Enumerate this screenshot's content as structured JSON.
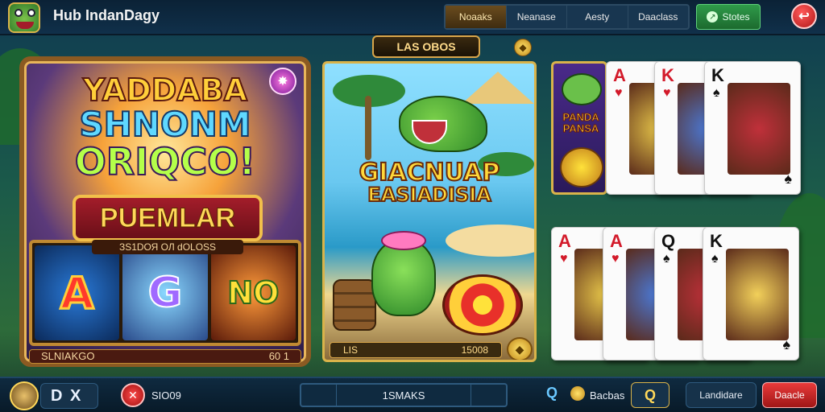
{
  "header": {
    "app_title": "Hub IndanDagy",
    "tabs": [
      "Noaaks",
      "Neanase",
      "Aesty",
      "Daaclass"
    ],
    "active_tab": 0,
    "stats_label": "Stotes",
    "stats_icon": "chart-icon",
    "close_icon": "close-icon"
  },
  "slot": {
    "headline_1": "YADDABA",
    "headline_2": "SHNONM",
    "headline_3": "ORIQCO!",
    "banner": "PUEMLAR",
    "banner_sub": "ЗS1DОЯ ОЛ dOLOSS",
    "reels": [
      "A",
      "G",
      "NO"
    ],
    "footer_left": "SLNIAKGO",
    "footer_right": "60 1",
    "gem_icon": "gem-icon"
  },
  "scene": {
    "top_badge": "LAS OBOS",
    "title_line1": "GIACNUAP",
    "title_line2": "EASIADISIA",
    "footer_left": "LІS",
    "footer_right": "15008",
    "coin_icon": "coin-icon"
  },
  "right_panel": {
    "game_card_title": "PANDA PANSA",
    "cards_top": [
      {
        "rank": "A",
        "suit": "♥",
        "color": "#d31a2a"
      },
      {
        "rank": "K",
        "suit": "♥",
        "color": "#d31a2a"
      },
      {
        "rank": "K",
        "suit": "♠",
        "color": "#111111"
      }
    ],
    "cards_bottom": [
      {
        "rank": "A",
        "suit": "♥",
        "color": "#d31a2a"
      },
      {
        "rank": "A",
        "suit": "♥",
        "color": "#d31a2a"
      },
      {
        "rank": "Q",
        "suit": "♠",
        "color": "#111111"
      },
      {
        "rank": "K",
        "suit": "♠",
        "color": "#111111"
      }
    ]
  },
  "footer": {
    "player_box": "D X",
    "label_1": "SIO09",
    "center_label": "1SMAKS",
    "search_glyph": "Q",
    "label_2": "Bacbas",
    "search_button": "Q",
    "button_1": "Landidare",
    "button_2": "Daacle"
  }
}
